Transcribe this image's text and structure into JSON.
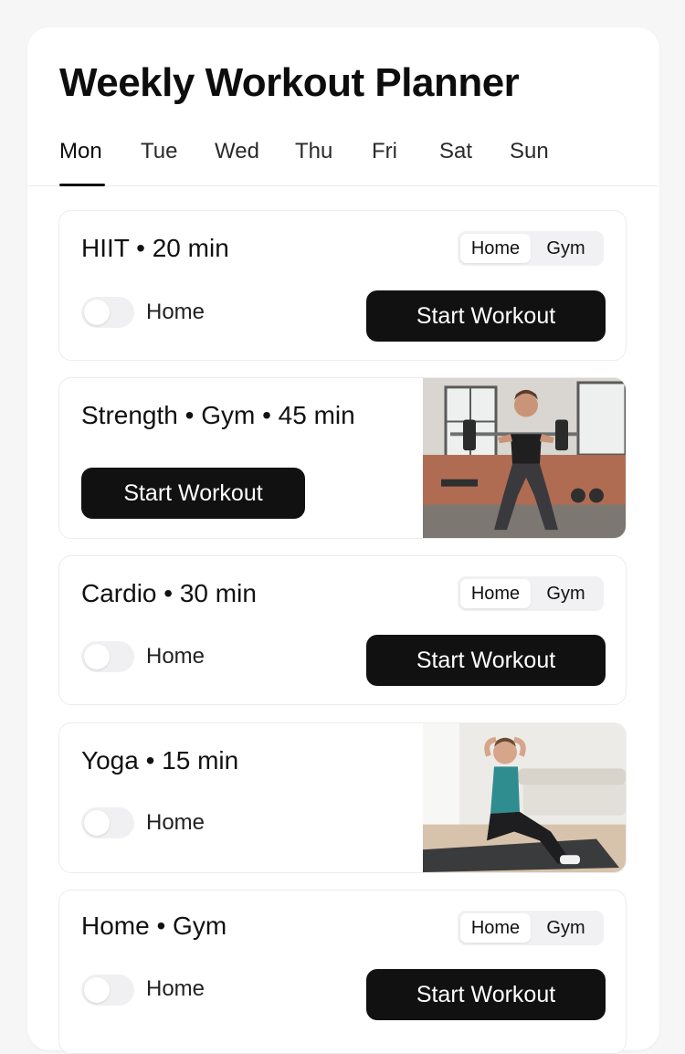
{
  "app": {
    "title": "Weekly Workout Planner"
  },
  "tabs": [
    {
      "label": "Mon",
      "active": true
    },
    {
      "label": "Tue",
      "active": false
    },
    {
      "label": "Wed",
      "active": false
    },
    {
      "label": "Thu",
      "active": false
    },
    {
      "label": "Fri",
      "active": false
    },
    {
      "label": "Sat",
      "active": false
    },
    {
      "label": "Sun",
      "active": false
    }
  ],
  "cards": [
    {
      "title": "HIIT • 20 min",
      "location_options": [
        "Home",
        "Gym"
      ],
      "selected_location": "Home",
      "toggle_label": "Home",
      "toggle_on": false,
      "button_label": "Start Workout"
    },
    {
      "title": "Strength • Gym • 45 min",
      "button_label": "Start Workout",
      "image": "woman-barbell-squat-photo"
    },
    {
      "title": "Cardio • 30 min",
      "location_options": [
        "Home",
        "Gym"
      ],
      "selected_location": "Home",
      "toggle_label": "Home",
      "toggle_on": false,
      "button_label": "Start Workout"
    },
    {
      "title": "Yoga • 15 min",
      "toggle_label": "Home",
      "toggle_on": false,
      "image": "woman-yoga-situp-photo"
    },
    {
      "title": "Home • Gym",
      "location_options": [
        "Home",
        "Gym"
      ],
      "selected_location": "Home",
      "toggle_label": "Home",
      "toggle_on": false,
      "button_label": "Start Workout"
    }
  ],
  "colors": {
    "primary_button": "#111111",
    "page_background": "#f6f6f7",
    "card_border": "#ececee",
    "toggle_off": "#f0f0f2"
  }
}
